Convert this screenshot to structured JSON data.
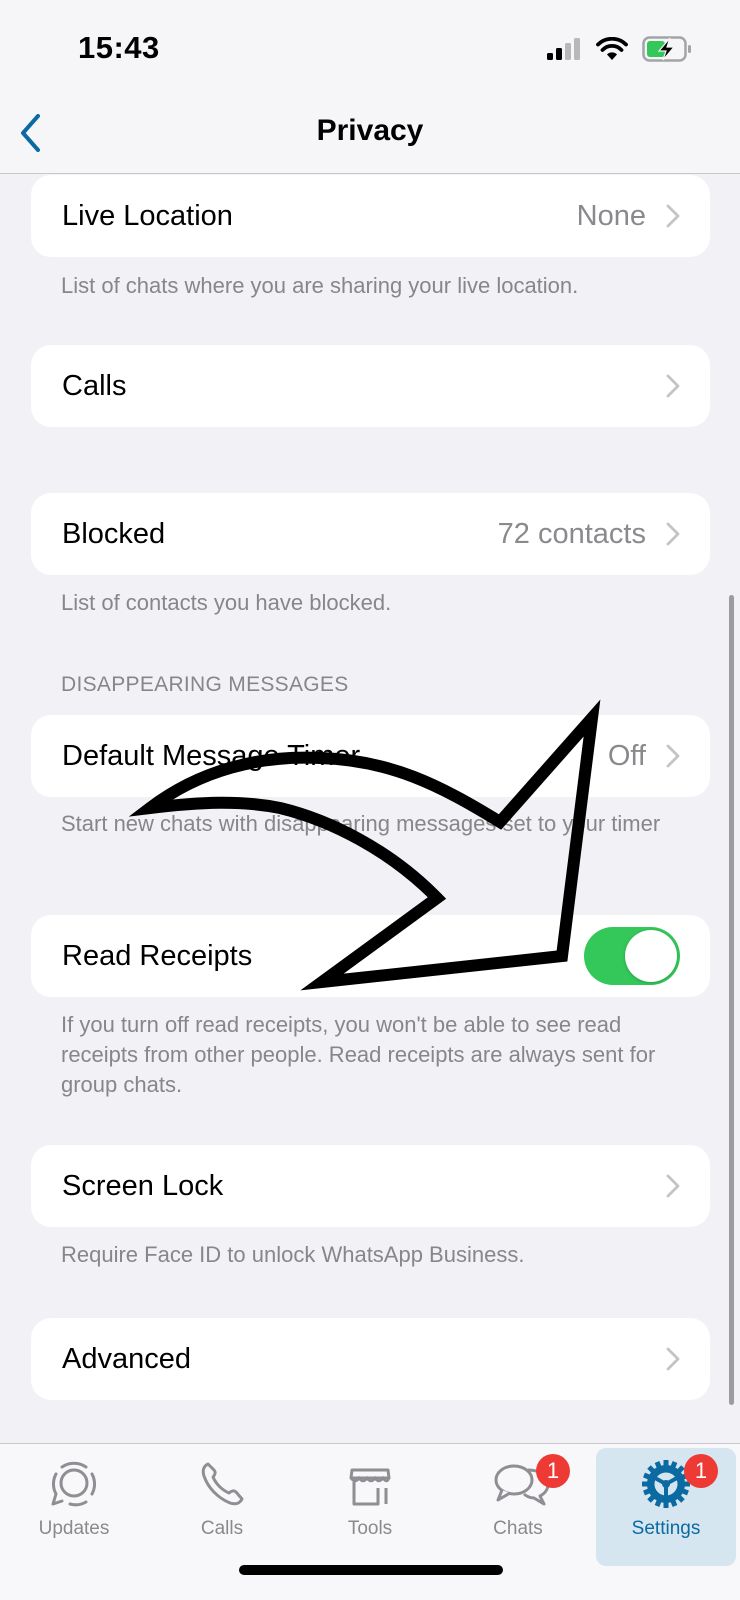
{
  "status_bar": {
    "time": "15:43",
    "signal_icon": "cellular-signal-icon",
    "wifi_icon": "wifi-icon",
    "battery_icon": "battery-charging-icon"
  },
  "nav": {
    "back_icon": "chevron-left-icon",
    "title": "Privacy"
  },
  "rows": {
    "live_location": {
      "label": "Live Location",
      "value": "None",
      "footer": "List of chats where you are sharing your live location."
    },
    "calls": {
      "label": "Calls"
    },
    "blocked": {
      "label": "Blocked",
      "value": "72 contacts",
      "footer": "List of contacts you have blocked."
    },
    "disappearing_header": "DISAPPEARING MESSAGES",
    "default_timer": {
      "label": "Default Message Timer",
      "value": "Off",
      "footer": "Start new chats with disappearing messages set to your timer"
    },
    "read_receipts": {
      "label": "Read Receipts",
      "enabled": true,
      "footer": "If you turn off read receipts, you won't be able to see read receipts from other people. Read receipts are always sent for group chats."
    },
    "screen_lock": {
      "label": "Screen Lock",
      "footer": "Require Face ID to unlock WhatsApp Business."
    },
    "advanced": {
      "label": "Advanced"
    }
  },
  "tabs": [
    {
      "label": "Updates",
      "icon": "updates-icon",
      "badge": null
    },
    {
      "label": "Calls",
      "icon": "phone-icon",
      "badge": null
    },
    {
      "label": "Tools",
      "icon": "storefront-icon",
      "badge": null
    },
    {
      "label": "Chats",
      "icon": "chat-bubbles-icon",
      "badge": "1"
    },
    {
      "label": "Settings",
      "icon": "gear-icon",
      "badge": "1",
      "active": true
    }
  ],
  "colors": {
    "accent": "#0b6aa2",
    "toggle_on": "#34c759",
    "badge": "#ee3a34",
    "background": "#f1f1f6",
    "secondary_text": "#86868b"
  },
  "annotation": {
    "icon": "curved-arrow-annotation"
  }
}
